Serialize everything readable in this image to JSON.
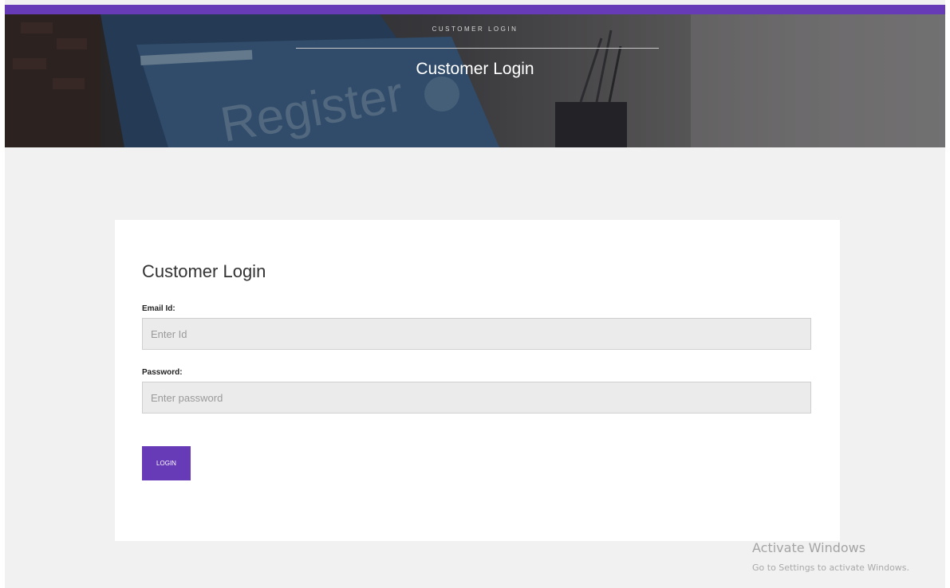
{
  "hero": {
    "breadcrumb": "CUSTOMER LOGIN",
    "title": "Customer Login",
    "background_word": "Register"
  },
  "form": {
    "title": "Customer Login",
    "email": {
      "label": "Email Id:",
      "placeholder": "Enter Id",
      "value": ""
    },
    "password": {
      "label": "Password:",
      "placeholder": "Enter password",
      "value": ""
    },
    "submit_label": "LOGIN"
  },
  "watermark": {
    "title": "Activate Windows",
    "subtitle": "Go to Settings to activate Windows."
  },
  "colors": {
    "accent": "#673ab7",
    "page_background": "#f1f1f1",
    "card_background": "#ffffff",
    "input_background": "#ebebeb"
  }
}
